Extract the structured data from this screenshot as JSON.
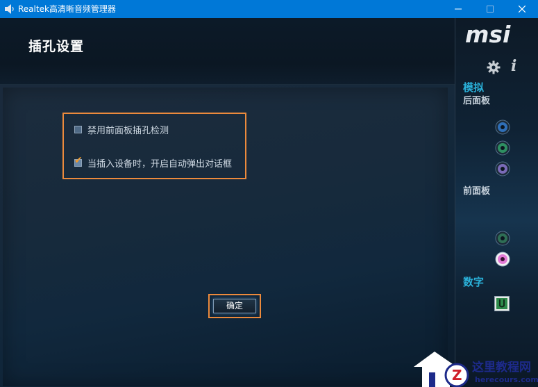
{
  "window": {
    "title": "Realtek高清晰音频管理器",
    "minimize_glyph": "—",
    "maximize_glyph": "☐",
    "close_glyph": "✕"
  },
  "page": {
    "title": "插孔设置"
  },
  "options": [
    {
      "label": "禁用前面板插孔检测",
      "checked": false
    },
    {
      "label": "当插入设备时，开启自动弹出对话框",
      "checked": true
    }
  ],
  "ok_button": {
    "label": "确定"
  },
  "sidebar": {
    "brand": "msi",
    "analog_header": "模拟",
    "back_panel_label": "后面板",
    "front_panel_label": "前面板",
    "digital_header": "数字",
    "back_jacks": [
      {
        "name": "blue-jack",
        "color": "#2f6fb8"
      },
      {
        "name": "green-jack",
        "color": "#2e8f62"
      },
      {
        "name": "purple-jack",
        "color": "#7a6bb8"
      }
    ],
    "front_jacks": [
      {
        "name": "green-jack",
        "color": "#2e6e55"
      },
      {
        "name": "pink-jack",
        "color": "#e37ad6"
      }
    ]
  },
  "watermark": {
    "site_name": "这里教程网",
    "url": "herecours.com"
  },
  "colors": {
    "highlight": "#ec8a3c",
    "accent": "#2ab0d8",
    "titlebar": "#0078d7"
  }
}
